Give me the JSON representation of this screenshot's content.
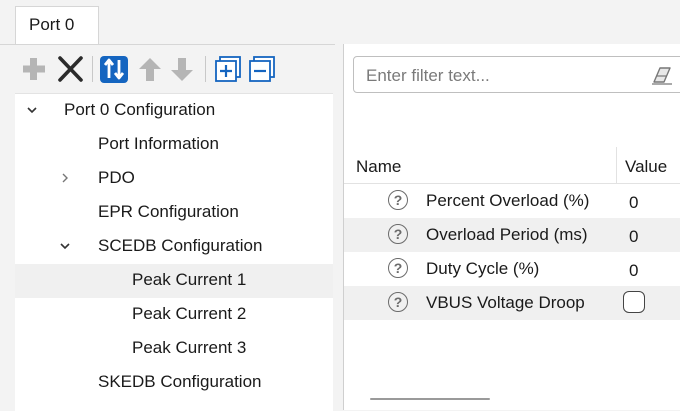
{
  "tab": {
    "label": "Port 0"
  },
  "toolbar": {
    "buttons": [
      {
        "name": "add-button",
        "icon": "plus-icon",
        "enabled": false
      },
      {
        "name": "delete-button",
        "icon": "x-icon",
        "enabled": true
      },
      {
        "name": "sort-button",
        "icon": "sort-icon",
        "enabled": true
      },
      {
        "name": "move-up-button",
        "icon": "arrow-up-icon",
        "enabled": false
      },
      {
        "name": "move-down-button",
        "icon": "arrow-down-icon",
        "enabled": false
      },
      {
        "name": "expand-all-button",
        "icon": "expand-all-icon",
        "enabled": true
      },
      {
        "name": "collapse-all-button",
        "icon": "collapse-all-icon",
        "enabled": true
      }
    ],
    "accent": "#1565c0"
  },
  "tree": {
    "nodes": [
      {
        "label": "Port 0 Configuration",
        "chevron": "expanded"
      },
      {
        "label": "Port Information",
        "chevron": "none"
      },
      {
        "label": "PDO",
        "chevron": "collapsed"
      },
      {
        "label": "EPR Configuration",
        "chevron": "none"
      },
      {
        "label": "SCEDB Configuration",
        "chevron": "expanded"
      },
      {
        "label": "Peak Current 1",
        "chevron": "none",
        "selected": true
      },
      {
        "label": "Peak Current 2",
        "chevron": "none"
      },
      {
        "label": "Peak Current 3",
        "chevron": "none"
      },
      {
        "label": "SKEDB Configuration",
        "chevron": "none"
      }
    ]
  },
  "filter": {
    "placeholder": "Enter filter text...",
    "value": ""
  },
  "grid": {
    "columns": [
      "Name",
      "Value"
    ],
    "rows": [
      {
        "name": "Percent Overload (%)",
        "value": "0",
        "type": "number"
      },
      {
        "name": "Overload Period (ms)",
        "value": "0",
        "type": "number"
      },
      {
        "name": "Duty Cycle (%)",
        "value": "0",
        "type": "number"
      },
      {
        "name": "VBUS Voltage Droop",
        "value": false,
        "type": "checkbox"
      }
    ],
    "help_icon_glyph": "?"
  }
}
